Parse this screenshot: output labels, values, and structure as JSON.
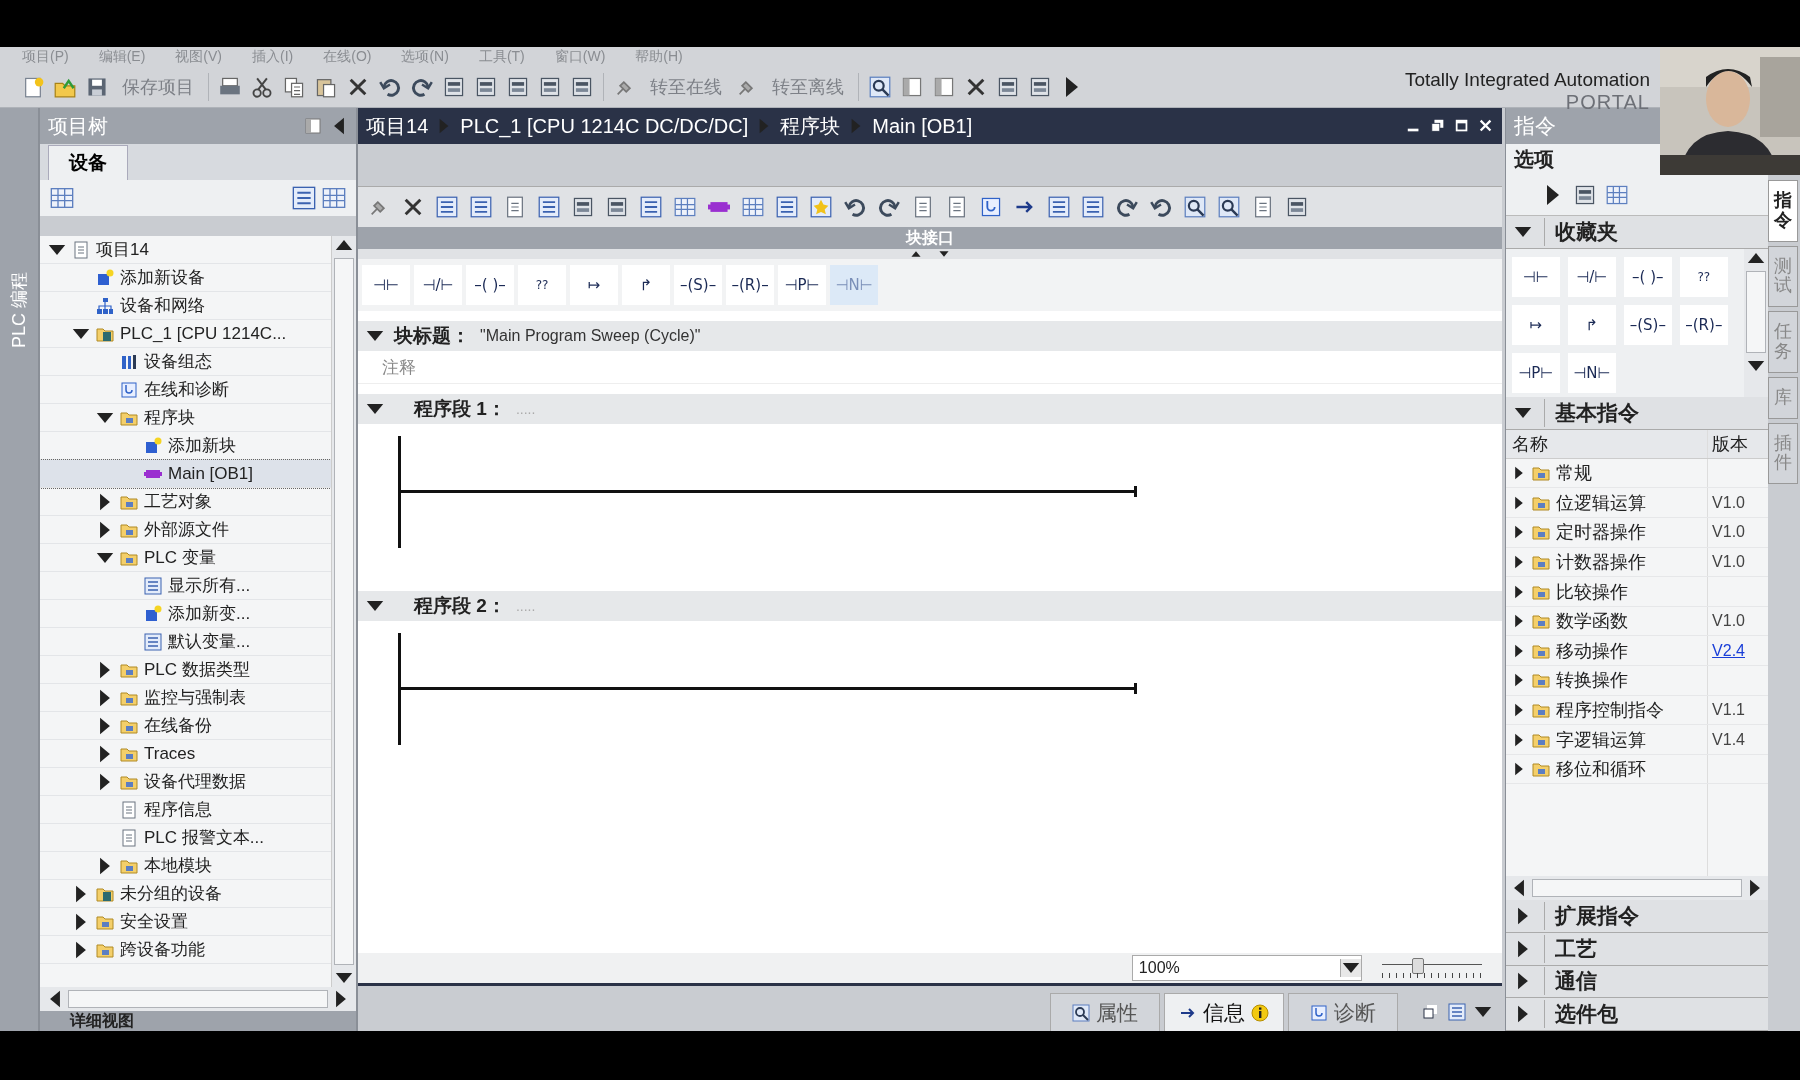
{
  "menu": [
    "项目(P)",
    "编辑(E)",
    "视图(V)",
    "插入(I)",
    "在线(O)",
    "选项(N)",
    "工具(T)",
    "窗口(W)",
    "帮助(H)"
  ],
  "toolbar": {
    "save": "保存项目",
    "go_online": "转至在线",
    "go_offline": "转至离线"
  },
  "brand": {
    "title": "Totally Integrated Automation",
    "subtitle": "PORTAL"
  },
  "webcam": {
    "kind": "picture"
  },
  "side_tab": "PLC 编程",
  "project_tree": {
    "title": "项目树",
    "tabs": [
      {
        "label": "设备",
        "selected": true
      }
    ],
    "items": [
      {
        "label": "项目14",
        "kind": "doc",
        "expanded": true,
        "selected": false,
        "children": [
          {
            "label": "添加新设备",
            "kind": "add",
            "selected": false
          },
          {
            "label": "设备和网络",
            "kind": "net",
            "selected": false
          },
          {
            "label": "PLC_1 [CPU 1214C...",
            "kind": "plc",
            "expanded": true,
            "selected": false,
            "children": [
              {
                "label": "设备组态",
                "kind": "cfg",
                "selected": false
              },
              {
                "label": "在线和诊断",
                "kind": "diag",
                "selected": false
              },
              {
                "label": "程序块",
                "kind": "folder",
                "expanded": true,
                "selected": false,
                "children": [
                  {
                    "label": "添加新块",
                    "kind": "add",
                    "selected": false
                  },
                  {
                    "label": "Main [OB1]",
                    "kind": "block",
                    "selected": true
                  }
                ]
              },
              {
                "label": "工艺对象",
                "kind": "folder",
                "expanded": false,
                "selected": false
              },
              {
                "label": "外部源文件",
                "kind": "folder",
                "expanded": false,
                "selected": false
              },
              {
                "label": "PLC 变量",
                "kind": "folder",
                "expanded": true,
                "selected": false,
                "children": [
                  {
                    "label": "显示所有...",
                    "kind": "list",
                    "selected": false
                  },
                  {
                    "label": "添加新变...",
                    "kind": "add",
                    "selected": false
                  },
                  {
                    "label": "默认变量...",
                    "kind": "list",
                    "selected": false
                  }
                ]
              },
              {
                "label": "PLC 数据类型",
                "kind": "folder",
                "expanded": false,
                "selected": false
              },
              {
                "label": "监控与强制表",
                "kind": "folder",
                "expanded": false,
                "selected": false
              },
              {
                "label": "在线备份",
                "kind": "folder",
                "expanded": false,
                "selected": false
              },
              {
                "label": "Traces",
                "kind": "folder",
                "expanded": false,
                "selected": false
              },
              {
                "label": "设备代理数据",
                "kind": "folder",
                "expanded": false,
                "selected": false
              },
              {
                "label": "程序信息",
                "kind": "doc",
                "selected": false
              },
              {
                "label": "PLC 报警文本...",
                "kind": "doc",
                "selected": false
              },
              {
                "label": "本地模块",
                "kind": "folder",
                "expanded": false,
                "selected": false
              }
            ]
          },
          {
            "label": "未分组的设备",
            "kind": "plc",
            "expanded": false,
            "selected": false
          },
          {
            "label": "安全设置",
            "kind": "folder",
            "expanded": false,
            "selected": false
          },
          {
            "label": "跨设备功能",
            "kind": "folder",
            "expanded": false,
            "selected": false
          }
        ]
      }
    ]
  },
  "detail_view": "详细视图",
  "editor": {
    "breadcrumb": [
      "项目14",
      "PLC_1 [CPU 1214C DC/DC/DC]",
      "程序块",
      "Main [OB1]"
    ],
    "interface_label": "块接口",
    "palette": [
      {
        "symbol": "⊣⊢",
        "selected": false
      },
      {
        "symbol": "⊣/⊢",
        "selected": false
      },
      {
        "symbol": "–( )–",
        "selected": false
      },
      {
        "symbol": "??",
        "selected": false
      },
      {
        "symbol": "↦",
        "selected": false
      },
      {
        "symbol": "↱",
        "selected": false
      },
      {
        "symbol": "–(S)–",
        "selected": false
      },
      {
        "symbol": "–(R)–",
        "selected": false
      },
      {
        "symbol": "⊣P⊢",
        "selected": false
      },
      {
        "symbol": "⊣N⊢",
        "selected": true
      }
    ],
    "block_title": {
      "label": "块标题：",
      "value": "\"Main Program Sweep (Cycle)\"",
      "comment_placeholder": "注释",
      "expanded": true
    },
    "networks": [
      {
        "title": "程序段 1：",
        "comment": ".....",
        "expanded": true
      },
      {
        "title": "程序段 2：",
        "comment": ".....",
        "expanded": true
      }
    ],
    "zoom": {
      "value": "100%",
      "level": 0.35
    }
  },
  "bottom_tabs": [
    {
      "label": "属性",
      "selected": false
    },
    {
      "label": "信息",
      "selected": true
    },
    {
      "label": "诊断",
      "selected": false
    }
  ],
  "instructions": {
    "title": "指令",
    "options_label": "选项",
    "favorites": {
      "title": "收藏夹",
      "expanded": true,
      "items": [
        "⊣⊢",
        "⊣/⊢",
        "–( )–",
        "??",
        "↦",
        "↱",
        "–(S)–",
        "–(R)–",
        "⊣P⊢",
        "⊣N⊢"
      ]
    },
    "basic": {
      "title": "基本指令",
      "expanded": true,
      "columns": [
        "名称",
        "版本"
      ],
      "rows": [
        {
          "name": "常规"
        },
        {
          "name": "位逻辑运算",
          "version": "V1.0",
          "link": false
        },
        {
          "name": "定时器操作",
          "version": "V1.0",
          "link": false
        },
        {
          "name": "计数器操作",
          "version": "V1.0",
          "link": false
        },
        {
          "name": "比较操作"
        },
        {
          "name": "数学函数",
          "version": "V1.0",
          "link": false
        },
        {
          "name": "移动操作",
          "version": "V2.4",
          "link": true
        },
        {
          "name": "转换操作"
        },
        {
          "name": "程序控制指令",
          "version": "V1.1",
          "link": false
        },
        {
          "name": "字逻辑运算",
          "version": "V1.4",
          "link": false
        },
        {
          "name": "移位和循环"
        }
      ]
    },
    "sections": [
      {
        "title": "扩展指令",
        "expanded": false
      },
      {
        "title": "工艺",
        "expanded": false
      },
      {
        "title": "通信",
        "expanded": false
      },
      {
        "title": "选件包",
        "expanded": false
      }
    ]
  },
  "right_tabs": [
    {
      "label": "指令",
      "selected": true
    },
    {
      "label": "测试",
      "selected": false
    },
    {
      "label": "任务",
      "selected": false
    },
    {
      "label": "库",
      "selected": false
    },
    {
      "label": "插件",
      "selected": false
    }
  ]
}
